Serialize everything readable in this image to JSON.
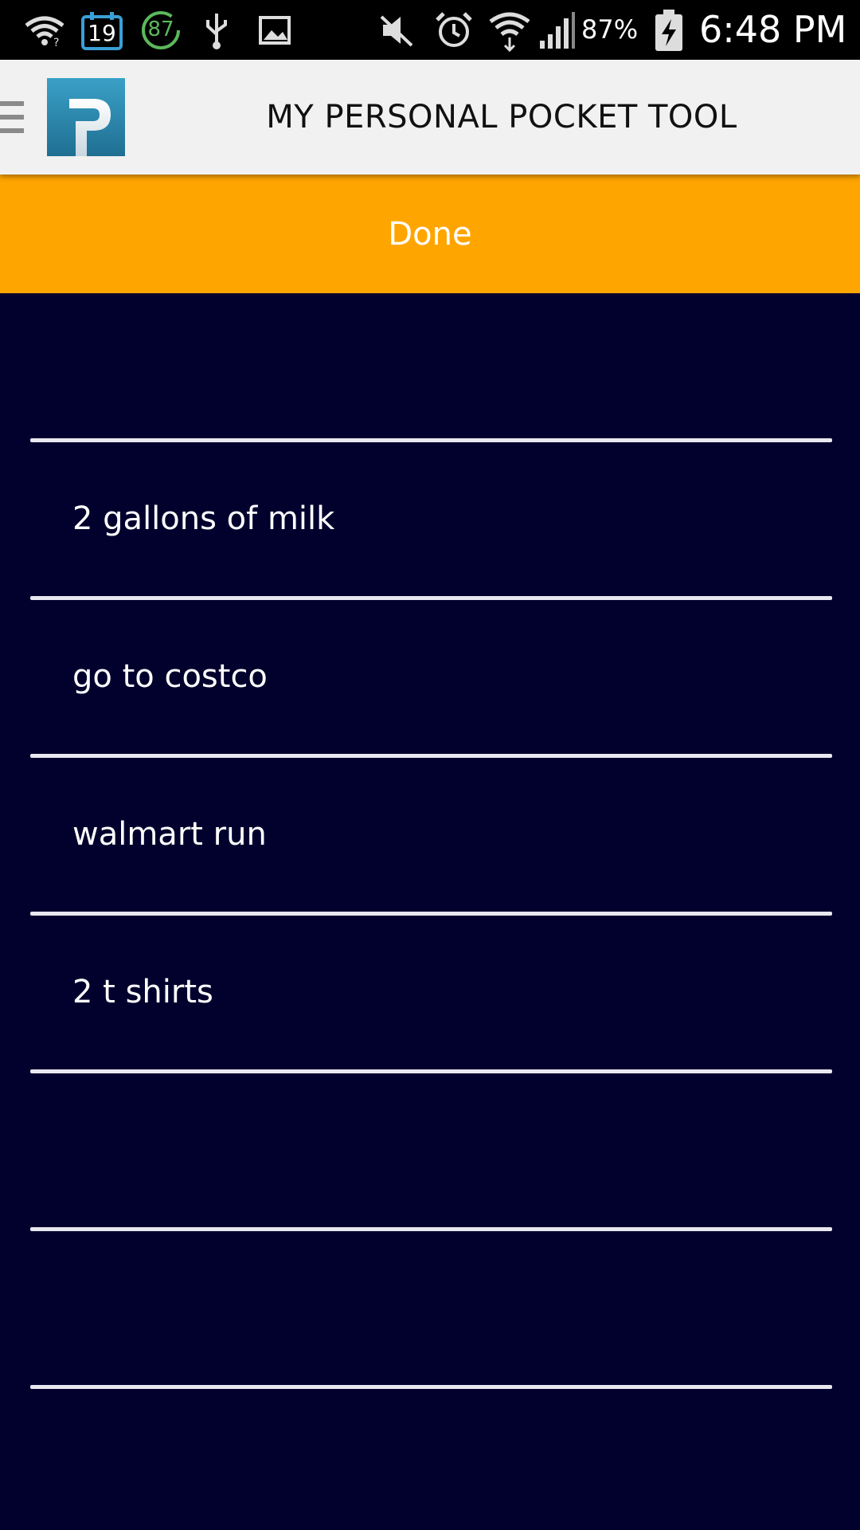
{
  "status_bar": {
    "calendar_day": "19",
    "badge_number": "87",
    "battery_percent": "87%",
    "time": "6:48 PM",
    "icons": [
      "wifi-notification-icon",
      "calendar-icon",
      "badge-icon",
      "usb-icon",
      "image-icon",
      "mute-icon",
      "alarm-icon",
      "wifi-icon",
      "signal-icon",
      "battery-charging-icon"
    ]
  },
  "app_bar": {
    "title": "MY PERSONAL POCKET TOOL",
    "logo_letter": "P",
    "menu_icon": "hamburger-icon"
  },
  "done_button": {
    "label": "Done"
  },
  "list": {
    "items": [
      {
        "text": ""
      },
      {
        "text": "2 gallons of milk"
      },
      {
        "text": "go to costco"
      },
      {
        "text": "walmart run"
      },
      {
        "text": "2 t shirts"
      },
      {
        "text": ""
      },
      {
        "text": ""
      }
    ]
  },
  "colors": {
    "status_bar": "#000000",
    "app_bar": "#f1f1f1",
    "accent_orange": "#ffa500",
    "list_background": "#02002d",
    "divider": "#e8e8f0",
    "text_light": "#ffffff"
  }
}
